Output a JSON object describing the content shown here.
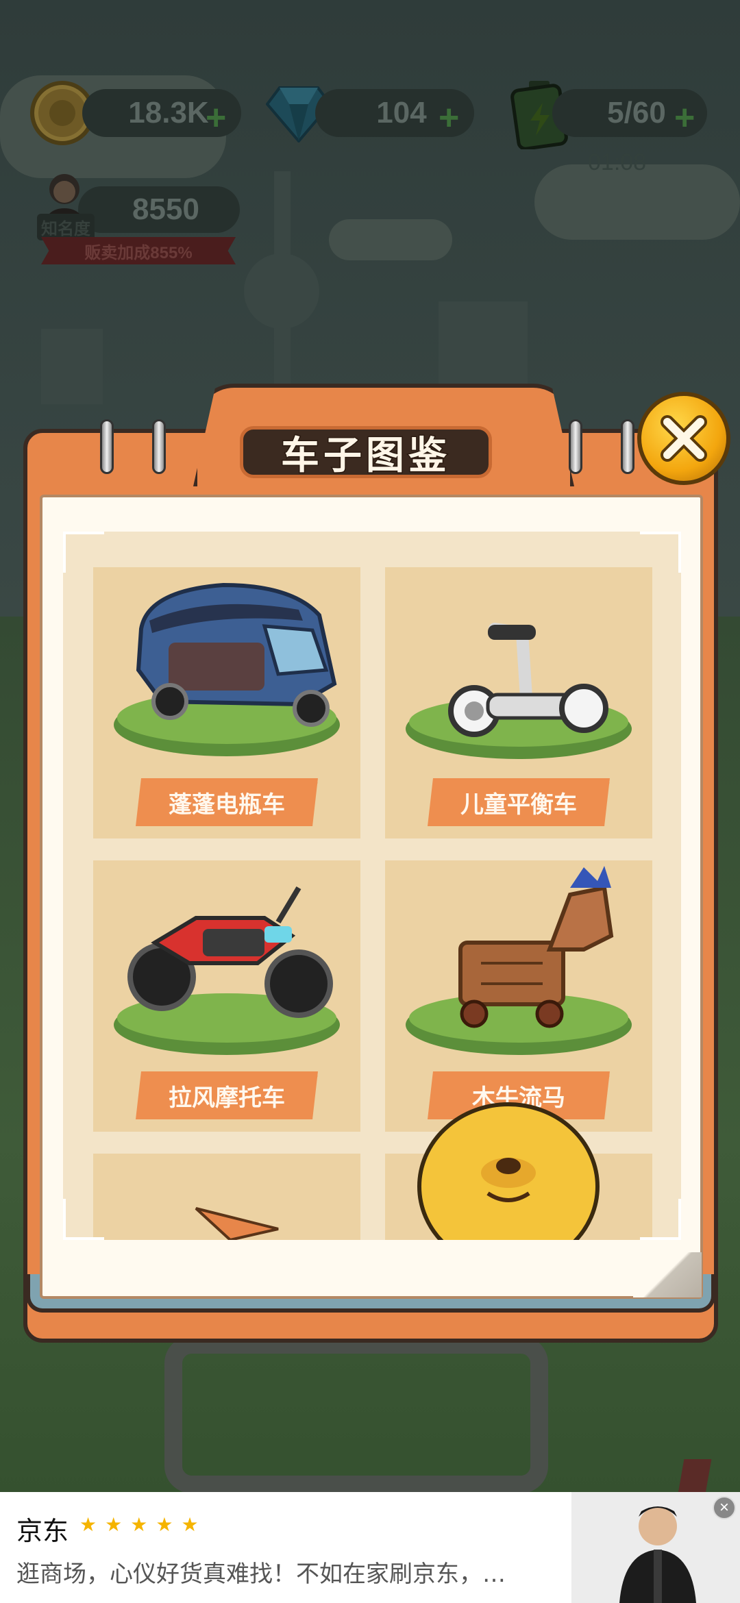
{
  "hud": {
    "coins": "18.3K",
    "gems": "104",
    "energy": "5/60",
    "energy_timer": "01:08",
    "fame_label": "知名度",
    "fame_value": "8550",
    "sale_bonus": "贩卖加成855%",
    "plus_symbol": "+"
  },
  "modal": {
    "title": "车子图鉴",
    "close_icon": "close-x-icon",
    "cards": [
      {
        "label": "蓬蓬电瓶车",
        "icon": "tuk-tuk-icon"
      },
      {
        "label": "儿童平衡车",
        "icon": "segway-icon"
      },
      {
        "label": "拉风摩托车",
        "icon": "motorcycle-icon"
      },
      {
        "label": "木牛流马",
        "icon": "wooden-horse-icon"
      }
    ]
  },
  "ad": {
    "brand": "京东",
    "stars": 5,
    "description": "逛商场，心仪好货真难找！不如在家刷京东，…",
    "close_symbol": "×"
  },
  "colors": {
    "accent_orange": "#e7864a",
    "label_orange": "#ee8e4f",
    "card_bg": "#ecd2a3",
    "close_gold": "#f3a60e"
  }
}
